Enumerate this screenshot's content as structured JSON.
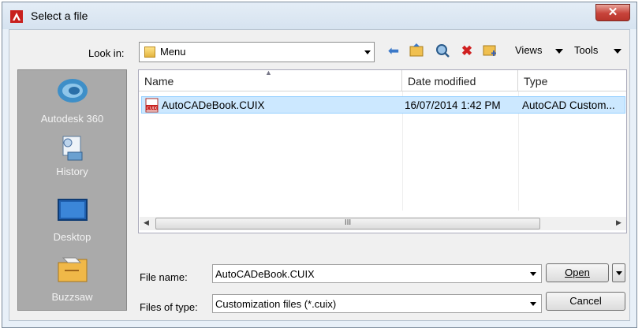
{
  "window": {
    "title": "Select a file",
    "close_glyph": "✕"
  },
  "lookin": {
    "label": "Look in:",
    "value": "Menu"
  },
  "toolbar": {
    "back_icon": "back-arrow-icon",
    "up_icon": "up-folder-icon",
    "search_icon": "search-web-icon",
    "delete_icon": "delete-icon",
    "newfolder_icon": "new-folder-icon",
    "views_label": "Views",
    "tools_label": "Tools"
  },
  "places": [
    {
      "label": "Autodesk 360",
      "icon": "autodesk-360-icon"
    },
    {
      "label": "History",
      "icon": "history-icon"
    },
    {
      "label": "Desktop",
      "icon": "desktop-icon"
    },
    {
      "label": "Buzzsaw",
      "icon": "buzzsaw-icon"
    }
  ],
  "filelist": {
    "columns": [
      "Name",
      "Date modified",
      "Type"
    ],
    "rows": [
      {
        "name": "AutoCADeBook.CUIX",
        "date": "16/07/2014 1:42 PM",
        "type": "AutoCAD Custom..."
      }
    ],
    "scroll_thumb_glyph": "III",
    "scroll_left": "◀",
    "scroll_right": "▶"
  },
  "filename": {
    "label": "File name:",
    "value": "AutoCADeBook.CUIX"
  },
  "filetype": {
    "label": "Files of type:",
    "value": "Customization files (*.cuix)"
  },
  "buttons": {
    "open": "Open",
    "cancel": "Cancel"
  },
  "colors": {
    "selection": "#cce8ff",
    "places_bg": "#aaaaaa",
    "title_bg": "#dae6f2",
    "close": "#c7433a"
  }
}
